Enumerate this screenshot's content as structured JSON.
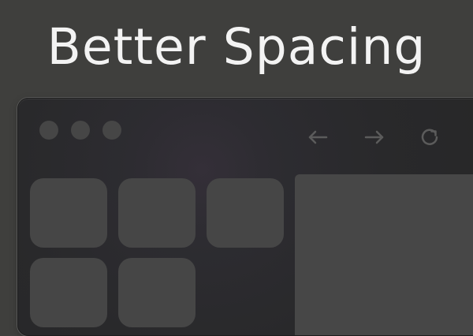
{
  "headline": {
    "text": "Better Spacing"
  },
  "browser": {
    "traffic_lights": [
      {
        "name": "close"
      },
      {
        "name": "minimize"
      },
      {
        "name": "zoom"
      }
    ],
    "navigation": {
      "back_icon": "arrow-left-icon",
      "forward_icon": "arrow-right-icon",
      "reload_icon": "reload-icon"
    },
    "tiles_count": 5
  },
  "colors": {
    "page_background": "#3f3f3d",
    "window_background": "#29292b",
    "tile_background": "#464646",
    "panel_background": "#474747",
    "icon_color": "#5b5b5b",
    "headline_color": "#f3f3f3"
  }
}
